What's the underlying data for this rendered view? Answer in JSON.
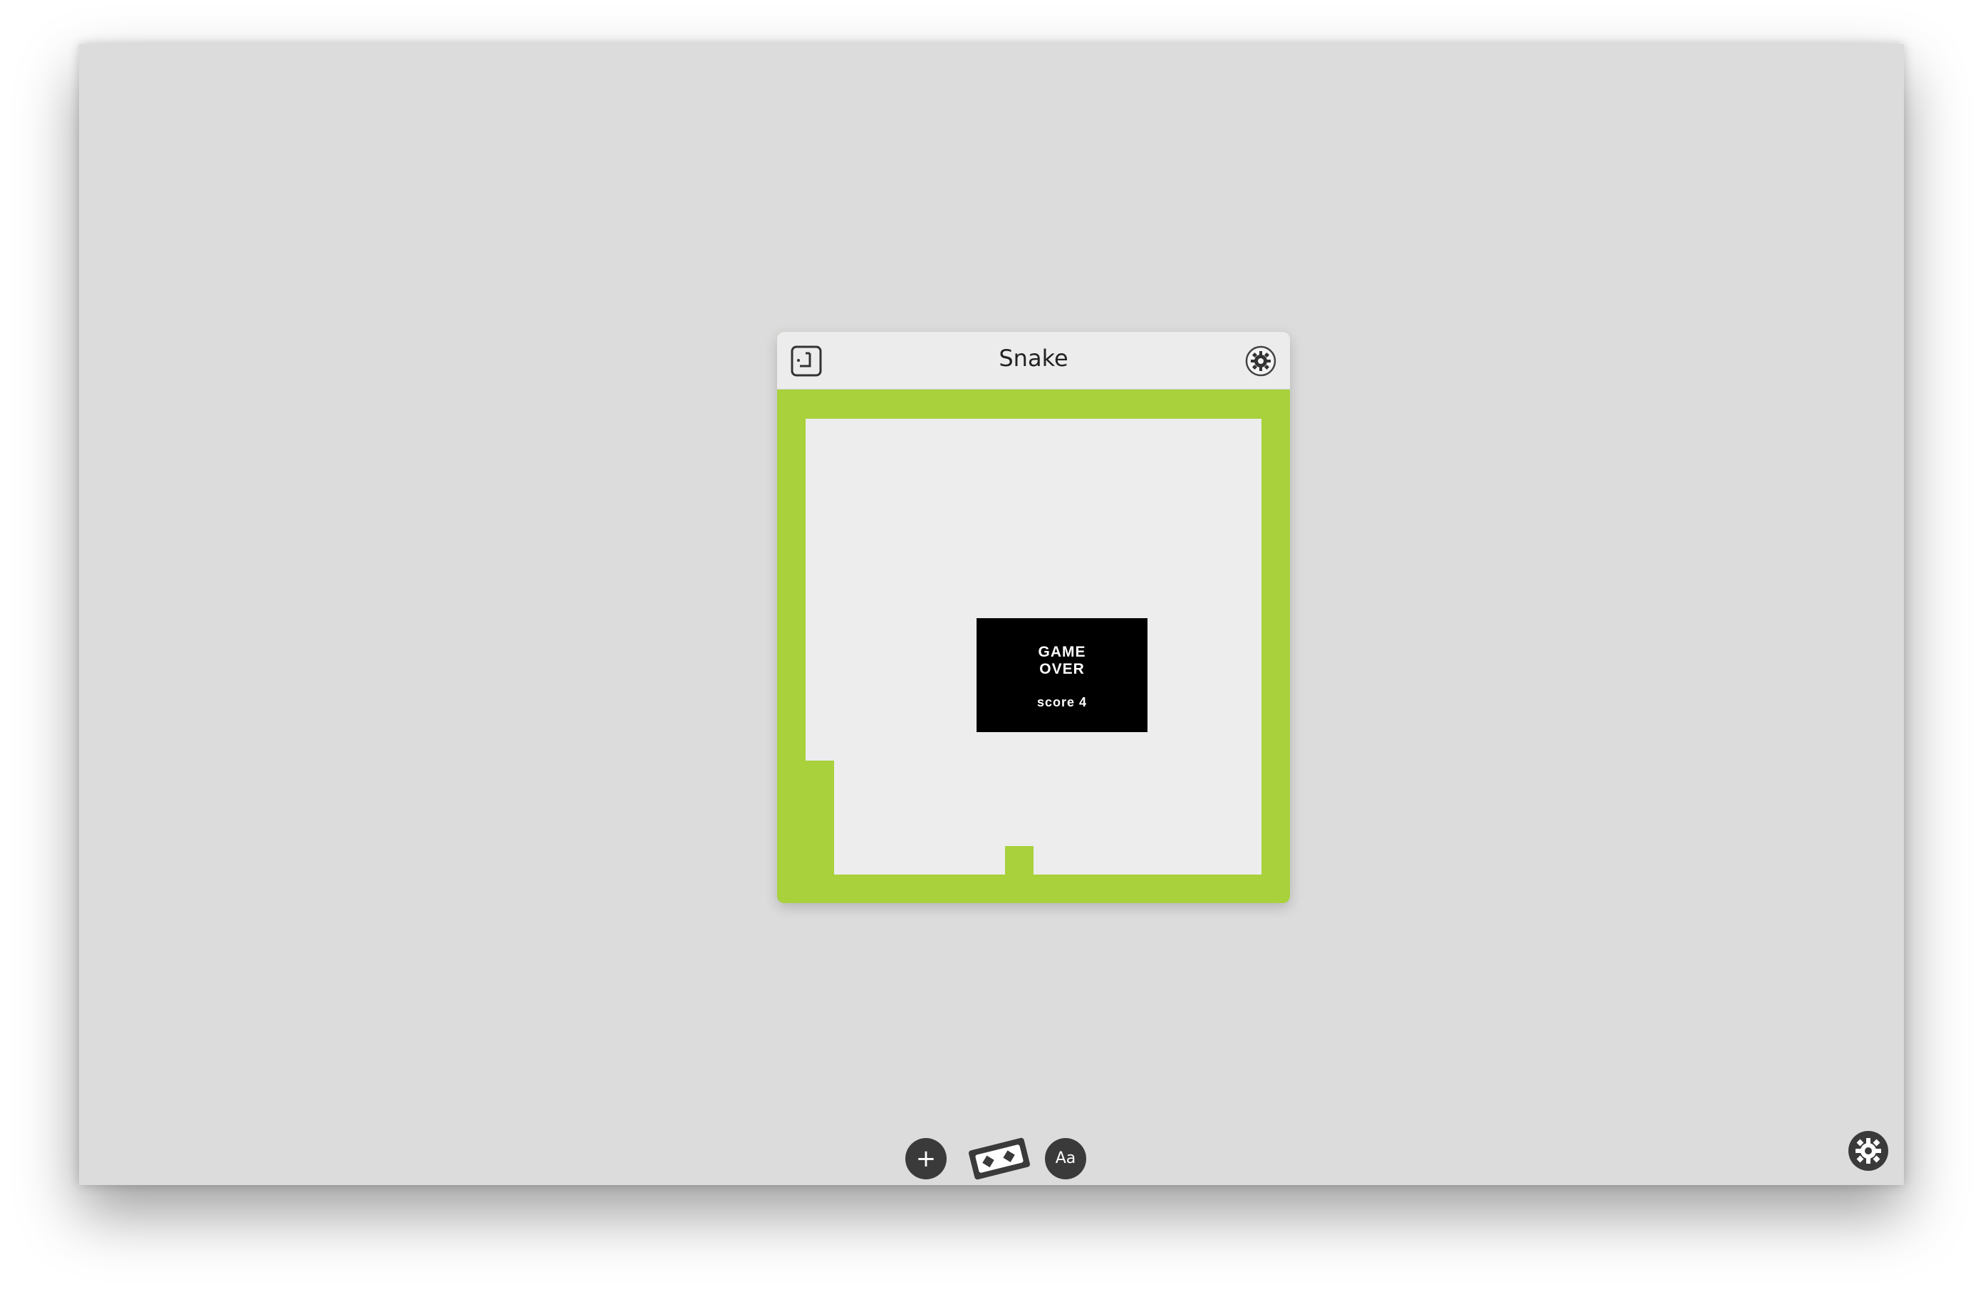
{
  "widget": {
    "title": "Snake",
    "flip_icon": "flip-widget-icon",
    "settings_icon": "gear-icon"
  },
  "game": {
    "game_over_line1": "GAME",
    "game_over_line2": "OVER",
    "score_text": "score 4"
  },
  "toolbar": {
    "add_label": "+",
    "add_icon": "plus-icon",
    "tickets_icon": "tickets-icon",
    "font_label": "Aa",
    "settings_icon": "gear-icon"
  },
  "colors": {
    "snake": "#a8d13b",
    "background": "#dcdcdc",
    "field": "#ededed"
  }
}
